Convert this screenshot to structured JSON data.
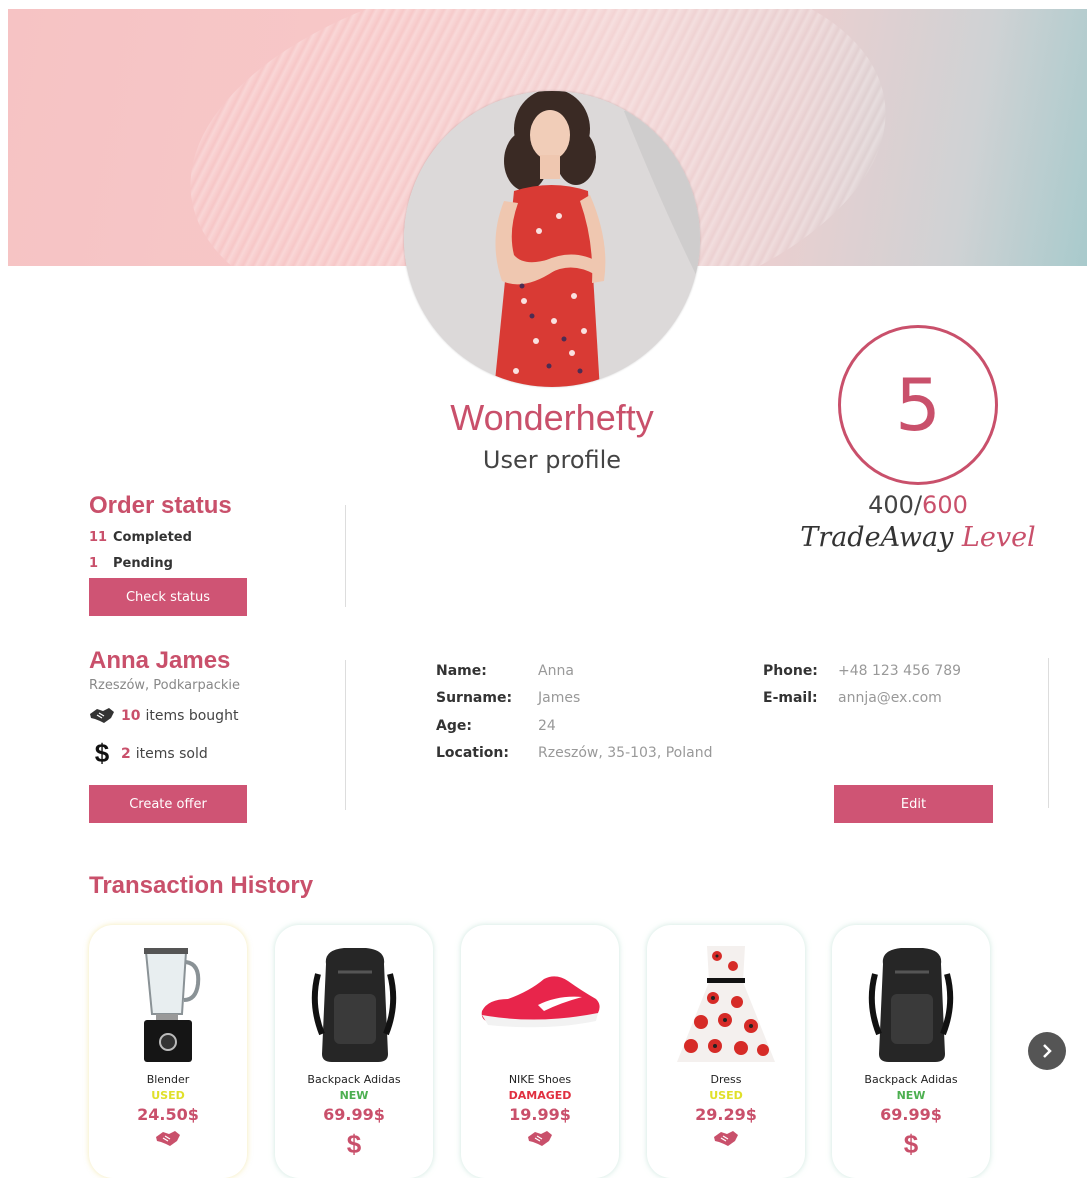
{
  "profile": {
    "username": "Wonderhefty",
    "subtitle": "User profile"
  },
  "level": {
    "value": "5",
    "points": "400/",
    "max_points": "600",
    "caption_prefix": "TradeAway ",
    "caption_suffix": "Level"
  },
  "order_status": {
    "title": "Order status",
    "completed_count": "11",
    "completed_label": "Completed",
    "pending_count": "1",
    "pending_label": "Pending",
    "button_label": "Check status"
  },
  "user": {
    "full_name": "Anna James",
    "region": "Rzeszów, Podkarpackie",
    "bought_count": "10",
    "bought_label": "items bought",
    "sold_count": "2",
    "sold_label": "items sold",
    "create_offer_label": "Create offer"
  },
  "details": {
    "name_label": "Name:",
    "name_value": "Anna",
    "surname_label": "Surname:",
    "surname_value": "James",
    "age_label": "Age:",
    "age_value": "24",
    "location_label": "Location:",
    "location_value": "Rzeszów, 35-103, Poland",
    "phone_label": "Phone:",
    "phone_value": "+48 123 456 789",
    "email_label": "E-mail:",
    "email_value": "annja@ex.com",
    "edit_label": "Edit"
  },
  "transactions": {
    "title": "Transaction History",
    "items": [
      {
        "name": "Blender",
        "condition": "USED",
        "condition_color": "#e6e62a",
        "price": "24.50$",
        "type_icon": "handshake-icon"
      },
      {
        "name": "Backpack Adidas",
        "condition": "NEW",
        "condition_color": "#4caf50",
        "price": "69.99$",
        "type_icon": "dollar-icon"
      },
      {
        "name": "NIKE Shoes",
        "condition": "DAMAGED",
        "condition_color": "#e03040",
        "price": "19.99$",
        "type_icon": "handshake-icon"
      },
      {
        "name": "Dress",
        "condition": "USED",
        "condition_color": "#e6e62a",
        "price": "29.29$",
        "type_icon": "handshake-icon"
      },
      {
        "name": "Backpack Adidas",
        "condition": "NEW",
        "condition_color": "#4caf50",
        "price": "69.99$",
        "type_icon": "dollar-icon"
      }
    ]
  },
  "colors": {
    "accent": "#c9506b",
    "button": "#cf5474"
  }
}
